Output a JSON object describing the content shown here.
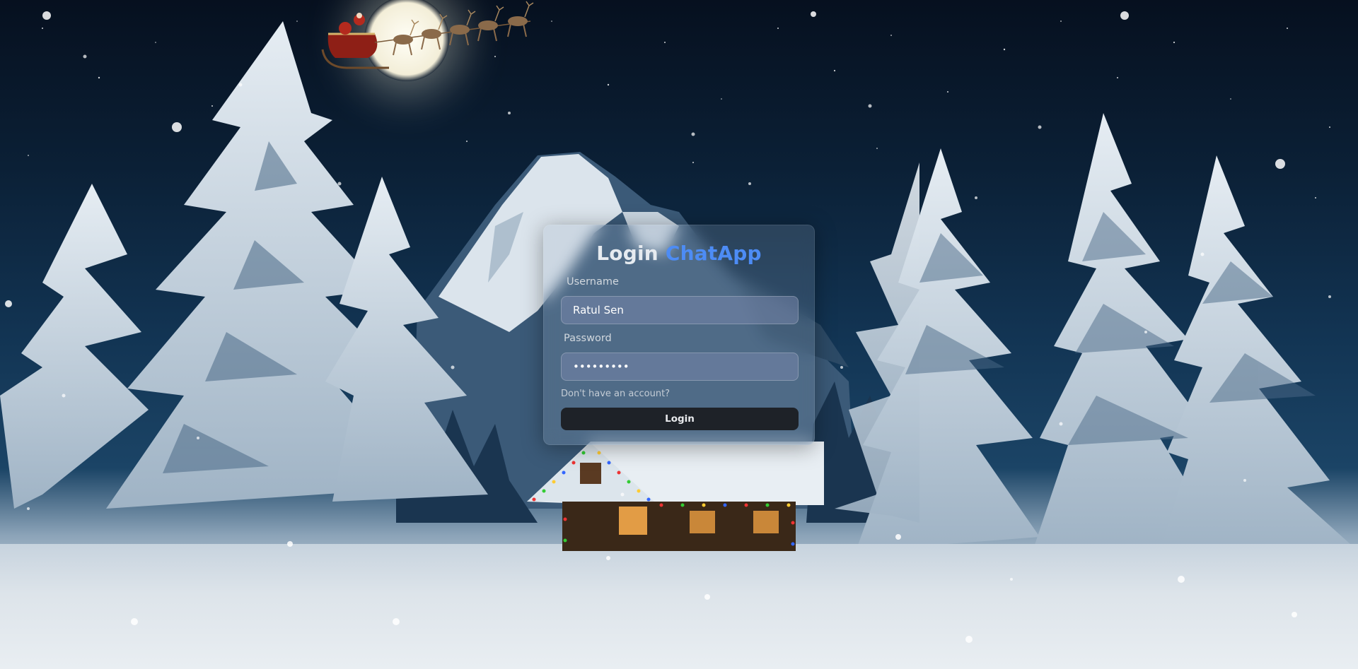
{
  "login": {
    "title_prefix": "Login",
    "title_brand": "ChatApp",
    "username_label": "Username",
    "username_value": "Ratul Sen",
    "password_label": "Password",
    "password_value": "•••••••••",
    "signup_link": "Don't have an account?",
    "submit_label": "Login"
  },
  "colors": {
    "brand_accent": "#4d8cf5",
    "button_bg": "#1e2228",
    "card_glass": "rgba(150,170,190,0.22)"
  },
  "background": {
    "scene": "snowy-night-forest-cabin",
    "elements": [
      "moon",
      "santa-sleigh-icon",
      "snowy-mountain",
      "pine-trees",
      "log-cabin",
      "snowfall"
    ]
  }
}
